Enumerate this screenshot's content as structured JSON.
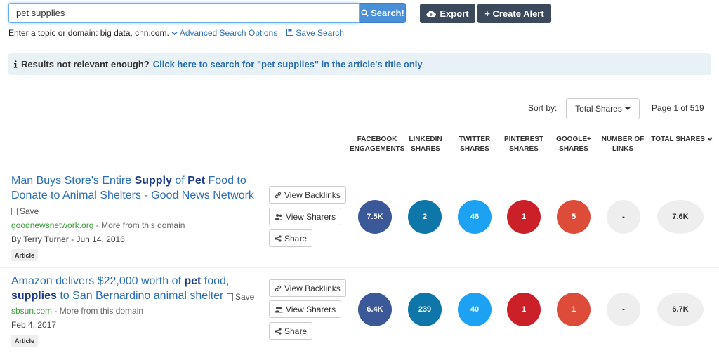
{
  "search": {
    "value": "pet supplies",
    "button_label": "Search!"
  },
  "toolbar": {
    "export_label": "Export",
    "create_alert_label": "+ Create Alert"
  },
  "hint": {
    "text": "Enter a topic or domain: big data, cnn.com.",
    "advanced_label": "Advanced Search Options",
    "save_search_label": "Save Search"
  },
  "banner": {
    "prefix": "Results not relevant enough?",
    "link": "Click here to search for \"pet supplies\" in the article's title only"
  },
  "sort": {
    "label": "Sort by:",
    "selected": "Total Shares",
    "page_info": "Page 1 of 519"
  },
  "columns": {
    "facebook": [
      "FACEBOOK",
      "ENGAGEMENTS"
    ],
    "linkedin": [
      "LINKEDIN",
      "SHARES"
    ],
    "twitter": [
      "TWITTER",
      "SHARES"
    ],
    "pinterest": [
      "PINTEREST",
      "SHARES"
    ],
    "googleplus": [
      "GOOGLE+",
      "SHARES"
    ],
    "links": [
      "NUMBER OF",
      "LINKS"
    ],
    "total": "TOTAL SHARES"
  },
  "colors": {
    "facebook": "#3b5998",
    "linkedin": "#0e76a8",
    "twitter": "#1da1f2",
    "pinterest": "#cb2027",
    "googleplus": "#dd4b39",
    "neutral": "#eeeeee"
  },
  "actions": {
    "backlinks": "View Backlinks",
    "sharers": "View Sharers",
    "share": "Share"
  },
  "results": [
    {
      "title_parts": [
        "Man Buys Store's Entire ",
        "Supply",
        " of ",
        "Pet",
        " Food to Donate to Animal Shelters - Good News Network"
      ],
      "save_label": "Save",
      "domain": "goodnewsnetwork.org",
      "more_label": " - More from this domain",
      "meta": "By Terry Turner - Jun 14, 2016",
      "tag": "Article",
      "facebook": "7.5K",
      "linkedin": "2",
      "twitter": "46",
      "pinterest": "1",
      "googleplus": "5",
      "links": "-",
      "total": "7.6K"
    },
    {
      "title_parts": [
        "Amazon delivers $22,000 worth of ",
        "pet",
        " food, ",
        "supplies",
        " to San Bernardino animal shelter"
      ],
      "save_label": "Save",
      "domain": "sbsun.com",
      "more_label": " - More from this domain",
      "meta": "Feb 4, 2017",
      "tag": "Article",
      "facebook": "6.4K",
      "linkedin": "239",
      "twitter": "40",
      "pinterest": "1",
      "googleplus": "1",
      "links": "-",
      "total": "6.7K"
    }
  ]
}
